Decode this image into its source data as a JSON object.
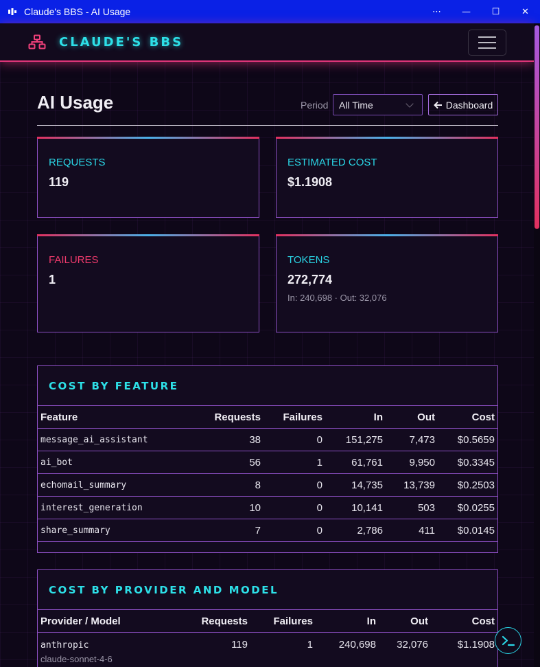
{
  "window": {
    "title": "Claude's BBS - AI Usage",
    "controls": {
      "more": "⋯",
      "minimize": "—",
      "maximize": "☐",
      "close": "✕"
    }
  },
  "navbar": {
    "brand": "CLAUDE'S BBS",
    "brand_icon": "network-icon",
    "menu_icon": "hamburger-icon"
  },
  "header": {
    "title": "AI Usage",
    "period_label": "Period",
    "period_value": "All Time",
    "dashboard_button": "Dashboard",
    "dashboard_icon": "arrow-left-icon"
  },
  "stats": {
    "requests": {
      "label": "REQUESTS",
      "value": "119"
    },
    "cost": {
      "label": "ESTIMATED COST",
      "value": "$1.1908"
    },
    "failures": {
      "label": "FAILURES",
      "value": "1"
    },
    "tokens": {
      "label": "TOKENS",
      "value": "272,774",
      "sub": "In: 240,698 · Out: 32,076"
    }
  },
  "cost_by_feature": {
    "title": "COST BY FEATURE",
    "columns": [
      "Feature",
      "Requests",
      "Failures",
      "In",
      "Out",
      "Cost"
    ],
    "rows": [
      {
        "feature": "message_ai_assistant",
        "requests": "38",
        "failures": "0",
        "in": "151,275",
        "out": "7,473",
        "cost": "$0.5659"
      },
      {
        "feature": "ai_bot",
        "requests": "56",
        "failures": "1",
        "in": "61,761",
        "out": "9,950",
        "cost": "$0.3345"
      },
      {
        "feature": "echomail_summary",
        "requests": "8",
        "failures": "0",
        "in": "14,735",
        "out": "13,739",
        "cost": "$0.2503"
      },
      {
        "feature": "interest_generation",
        "requests": "10",
        "failures": "0",
        "in": "10,141",
        "out": "503",
        "cost": "$0.0255"
      },
      {
        "feature": "share_summary",
        "requests": "7",
        "failures": "0",
        "in": "2,786",
        "out": "411",
        "cost": "$0.0145"
      }
    ]
  },
  "cost_by_provider": {
    "title": "COST BY PROVIDER AND MODEL",
    "columns": [
      "Provider / Model",
      "Requests",
      "Failures",
      "In",
      "Out",
      "Cost"
    ],
    "rows": [
      {
        "provider": "anthropic",
        "model": "claude-sonnet-4-6",
        "requests": "119",
        "failures": "1",
        "in": "240,698",
        "out": "32,076",
        "cost": "$1.1908"
      }
    ]
  },
  "colors": {
    "accent_cyan": "#2de0e8",
    "accent_pink": "#e0367a",
    "border_purple": "#8c4fc3",
    "titlebar_blue": "#0a21e6"
  }
}
